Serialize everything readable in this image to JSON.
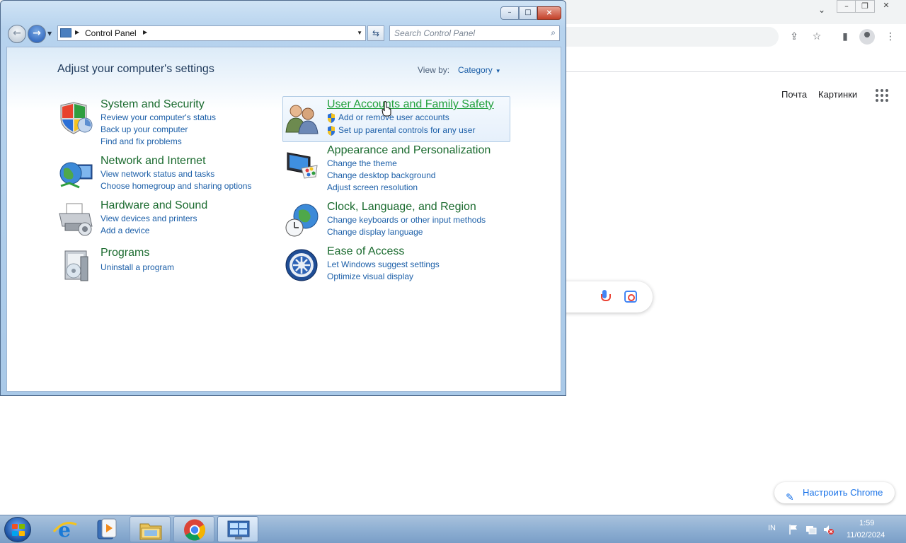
{
  "chrome": {
    "links": [
      "Почта",
      "Картинки"
    ],
    "customize_label": "Настроить Chrome"
  },
  "window": {
    "caption_buttons": {
      "minimize": "–",
      "maximize": "□",
      "close": "×"
    }
  },
  "nav": {
    "address_crumb": "Control Panel",
    "search_placeholder": "Search Control Panel"
  },
  "content": {
    "heading": "Adjust your computer's settings",
    "view_by_label": "View by:",
    "view_by_value": "Category",
    "categories": [
      {
        "title": "System and Security",
        "links": [
          "Review your computer's status",
          "Back up your computer",
          "Find and fix problems"
        ],
        "icon": "shield-icon"
      },
      {
        "title": "User Accounts and Family Safety",
        "links": [
          "Add or remove user accounts",
          "Set up parental controls for any user"
        ],
        "icon": "users-icon"
      },
      {
        "title": "Network and Internet",
        "links": [
          "View network status and tasks",
          "Choose homegroup and sharing options"
        ],
        "icon": "globe-network-icon"
      },
      {
        "title": "Appearance and Personalization",
        "links": [
          "Change the theme",
          "Change desktop background",
          "Adjust screen resolution"
        ],
        "icon": "monitor-palette-icon"
      },
      {
        "title": "Hardware and Sound",
        "links": [
          "View devices and printers",
          "Add a device"
        ],
        "icon": "printer-icon"
      },
      {
        "title": "Clock, Language, and Region",
        "links": [
          "Change keyboards or other input methods",
          "Change display language"
        ],
        "icon": "clock-globe-icon"
      },
      {
        "title": "Programs",
        "links": [
          "Uninstall a program"
        ],
        "icon": "programs-icon"
      },
      {
        "title": "Ease of Access",
        "links": [
          "Let Windows suggest settings",
          "Optimize visual display"
        ],
        "icon": "ease-of-access-icon"
      }
    ]
  },
  "taskbar": {
    "items": [
      "ie-icon",
      "media-player-icon",
      "explorer-icon",
      "chrome-icon",
      "control-panel-icon"
    ],
    "language": "IN",
    "time": "1:59",
    "date": "11/02/2024"
  },
  "colors": {
    "category_title": "#1b6b2f",
    "link": "#1c5fa8",
    "taskbar": "#8fb0d3"
  }
}
